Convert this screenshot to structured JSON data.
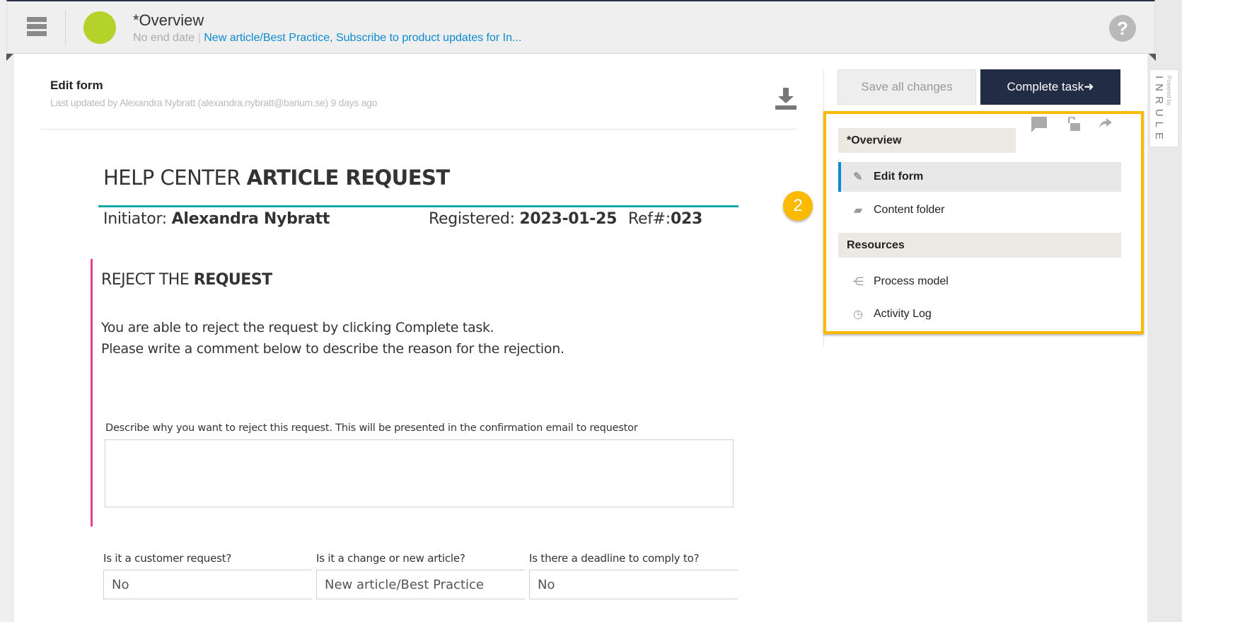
{
  "header": {
    "title": "*Overview",
    "no_end_date": "No end date",
    "separator": "|",
    "tags": "New article/Best Practice, Subscribe to product updates for In...",
    "help": "?",
    "status_color": "#b5d22a"
  },
  "edit_form": {
    "title": "Edit form",
    "last_updated": "Last updated by Alexandra Nybratt (alexandra.nybratt@barium.se) 9 days ago"
  },
  "form": {
    "title_light": "HELP CENTER",
    "title_bold": "ARTICLE REQUEST",
    "initiator_label": "Initiator:",
    "initiator": "Alexandra Nybratt",
    "registered_label": "Registered:",
    "registered": "2023-01-25",
    "ref_label": "Ref#:",
    "ref": "023",
    "reject_light": "REJECT THE",
    "reject_bold": "REQUEST",
    "para1": "You are able to reject the request by clicking Complete task.",
    "para2": "Please write a comment below to describe the reason for the rejection.",
    "comment_label": "Describe why you want to reject this request. This will be presented in the confirmation email to requestor",
    "comment_value": "",
    "fields": [
      {
        "label": "Is it a customer request?",
        "value": "No"
      },
      {
        "label": "Is it a change or new article?",
        "value": "New article/Best Practice"
      },
      {
        "label": "Is there a deadline to comply to?",
        "value": "No"
      }
    ]
  },
  "actions": {
    "save": "Save all changes",
    "complete": "Complete task",
    "complete_arrow": "➜"
  },
  "sidebar": {
    "overview": "*Overview",
    "items": [
      {
        "label": "Edit form",
        "icon": "edit-icon",
        "active": true
      },
      {
        "label": "Content folder",
        "icon": "folder-icon"
      }
    ],
    "resources": "Resources",
    "resource_items": [
      {
        "label": "Process model",
        "icon": "process-model-icon"
      },
      {
        "label": "Activity Log",
        "icon": "clock-icon"
      }
    ]
  },
  "badge": "2",
  "branding": {
    "powered_by": "Powered by",
    "logo": "INRULE"
  },
  "colors": {
    "accent": "#fbb900",
    "primary": "#222c45",
    "teal": "#14aaa8",
    "pink": "#e83e8c",
    "link": "#0a8ad0"
  }
}
